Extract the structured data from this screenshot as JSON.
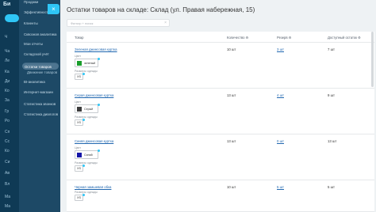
{
  "rail": {
    "logo": "Би",
    "items": [
      "Ч",
      "Ча",
      "Ле",
      "Ка",
      "Ди",
      "Кo",
      "За",
      "Гр",
      "Ро",
      "Сп",
      "Сс",
      "Ко",
      "Си",
      "Ав",
      "Вл",
      "Ма",
      "Ма",
      "Ма"
    ]
  },
  "menu": {
    "items": [
      {
        "label": "Продажи",
        "kind": "normal"
      },
      {
        "label": "Эффективность",
        "kind": "normal"
      },
      {
        "label": "Клиенты",
        "kind": "normal"
      },
      {
        "label": "Сквозная аналитика",
        "kind": "normal"
      },
      {
        "label": "Мои отчеты",
        "kind": "normal"
      },
      {
        "label": "Складской учёт",
        "kind": "normal"
      },
      {
        "label": "Остатки товаров",
        "kind": "active"
      },
      {
        "label": "Движение товаров",
        "kind": "sub"
      },
      {
        "label": "BI-аналитика",
        "kind": "normal"
      },
      {
        "label": "Интернет-магазин",
        "kind": "normal"
      },
      {
        "label": "Статистика звонков",
        "kind": "normal"
      },
      {
        "label": "Статистика диалогов",
        "kind": "normal"
      }
    ]
  },
  "panel": {
    "title": "Остатки товаров на складе: Склад (ул. Правая набережная, 15)",
    "filter_placeholder": "Фильтр + поиск",
    "close_icon": "×"
  },
  "grid": {
    "columns": [
      "Товар",
      "Количество ⚙",
      "Резерв ⚙",
      "Доступный остаток ⚙"
    ],
    "color_label": "Цвет",
    "size_label": "Размеры одежды",
    "rows": [
      {
        "name": "Зеленая джинсовая куртка",
        "color_name": "зеленый",
        "color_hex": "#1a9e2c",
        "size": "XS",
        "quantity": "10 шт",
        "reserve": "3 шт",
        "available": "7 шт"
      },
      {
        "name": "Серая джинсовая куртка",
        "color_name": "Серый",
        "color_hex": "#3c3c3c",
        "size": "XS",
        "quantity": "13 шт",
        "reserve": "4 шт",
        "available": "9 шт"
      },
      {
        "name": "Синяя джинсовая куртка",
        "color_name": "Синий",
        "color_hex": "#1515a8",
        "size": "XS",
        "quantity": "13 шт",
        "reserve": "0 шт",
        "available": "13 шт"
      },
      {
        "name": "Черная замшевая обка",
        "color_name": "",
        "color_hex": "",
        "size": "XS",
        "quantity": "10 шт",
        "reserve": "5 шт",
        "available": "5 шт"
      }
    ]
  },
  "colors": {
    "accent": "#2fc6f6",
    "link": "#2067b0",
    "sidebar": "#1d4966"
  }
}
